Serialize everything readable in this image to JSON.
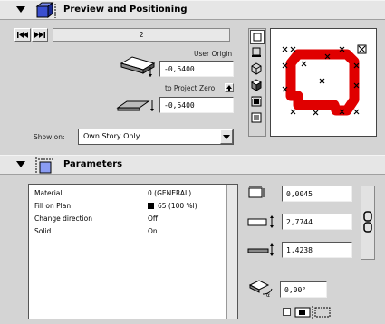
{
  "preview_section": {
    "title": "Preview and Positioning",
    "slider_value": "2",
    "user_origin_label": "User Origin",
    "user_origin_value": "-0,5400",
    "project_zero_label": "to Project Zero",
    "project_zero_value": "-0,5400",
    "show_on_label": "Show on:",
    "show_on_value": "Own Story Only"
  },
  "parameters_section": {
    "title": "Parameters",
    "rows": [
      {
        "name": "Material",
        "value": "0 (GENERAL)"
      },
      {
        "name": "Fill on Plan",
        "value": "65 (100 %l)"
      },
      {
        "name": "Change direction",
        "value": "Off"
      },
      {
        "name": "Solid",
        "value": "On"
      }
    ],
    "width_value": "0,0045",
    "depth_value": "2,7744",
    "height_value": "1,4238",
    "angle_value": "0,00°"
  },
  "colors": {
    "preview_shape": "#e00000",
    "panel_bg": "#d4d4d4"
  }
}
